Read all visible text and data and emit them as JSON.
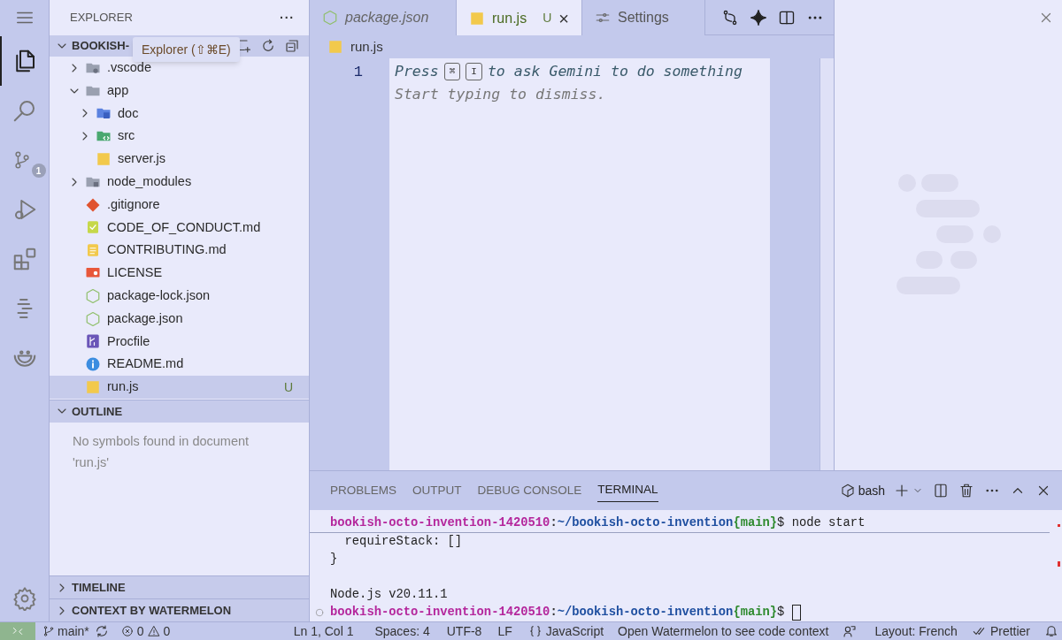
{
  "activity_bar": {
    "items": [
      {
        "kind": "files",
        "selected": true
      },
      {
        "kind": "search",
        "selected": false
      },
      {
        "kind": "scm",
        "selected": false,
        "badge": "1"
      },
      {
        "kind": "debug",
        "selected": false
      },
      {
        "kind": "extensions",
        "selected": false
      },
      {
        "kind": "timeline",
        "selected": false
      },
      {
        "kind": "smile",
        "selected": false
      }
    ]
  },
  "sidebar": {
    "title": "EXPLORER",
    "more": "···",
    "root": {
      "label": "BOOKISH-",
      "expanded": true
    },
    "tooltip": "Explorer (⇧⌘E)",
    "tree": [
      {
        "label": ".vscode",
        "kind": "vscode",
        "expanded": false,
        "selected": false
      },
      {
        "label": "app",
        "kind": "folder",
        "expanded": true,
        "selected": false,
        "children": [
          {
            "label": "doc",
            "kind": "docfolder",
            "expanded": false,
            "selected": false
          },
          {
            "label": "src",
            "kind": "srcfolder",
            "expanded": false,
            "selected": false
          },
          {
            "label": "server.js",
            "kind": "js",
            "selected": false
          }
        ]
      },
      {
        "label": "node_modules",
        "kind": "modules",
        "expanded": false,
        "selected": false
      },
      {
        "label": ".gitignore",
        "kind": "git",
        "selected": false
      },
      {
        "label": "CODE_OF_CONDUCT.md",
        "kind": "check",
        "selected": false
      },
      {
        "label": "CONTRIBUTING.md",
        "kind": "note",
        "selected": false
      },
      {
        "label": "LICENSE",
        "kind": "license",
        "selected": false
      },
      {
        "label": "package-lock.json",
        "kind": "node",
        "selected": false
      },
      {
        "label": "package.json",
        "kind": "node",
        "selected": false
      },
      {
        "label": "Procfile",
        "kind": "heroku",
        "selected": false
      },
      {
        "label": "README.md",
        "kind": "info",
        "selected": false
      },
      {
        "label": "run.js",
        "kind": "js",
        "selected": true,
        "badge": "U"
      }
    ],
    "sections": [
      {
        "title": "OUTLINE",
        "expanded": true,
        "message": "No symbols found in document 'run.js'"
      },
      {
        "title": "TIMELINE",
        "expanded": false
      },
      {
        "title": "CONTEXT BY WATERMELON",
        "expanded": false
      }
    ]
  },
  "editor": {
    "tabs": [
      {
        "label": "package.json",
        "kind": "node",
        "selected": false,
        "preview": true
      },
      {
        "label": "run.js",
        "kind": "js",
        "selected": true,
        "preview": false,
        "badge": "U",
        "close": "×"
      },
      {
        "label": "Settings",
        "kind": "settings",
        "selected": false,
        "preview": false
      }
    ],
    "breadcrumb": "run.js",
    "line_number": "1",
    "hint": {
      "press": "Press",
      "keys": [
        "⌘",
        "I"
      ],
      "rest": "to ask Gemini to do something",
      "second": "Start typing to dismiss."
    }
  },
  "panel": {
    "tabs": [
      {
        "label": "PROBLEMS",
        "selected": false
      },
      {
        "label": "OUTPUT",
        "selected": false
      },
      {
        "label": "DEBUG CONSOLE",
        "selected": false
      },
      {
        "label": "TERMINAL",
        "selected": true
      }
    ],
    "shell": "bash",
    "lines": [
      {
        "kind": "prompt",
        "segments": [
          {
            "text": "bookish-octo-invention-1420510",
            "color": "#b4269c"
          },
          {
            "text": ":",
            "color": "#333333"
          },
          {
            "text": "~/bookish-octo-invention",
            "color": "#1f4fa0"
          },
          {
            "text": "{main}",
            "color": "#2e8a2e"
          },
          {
            "text": "$ node start",
            "color": "#222222"
          }
        ],
        "cursor": false
      },
      {
        "kind": "output",
        "text": "  requireStack: []"
      },
      {
        "kind": "output",
        "text": "}"
      },
      {
        "kind": "blank"
      },
      {
        "kind": "output",
        "text": "Node.js v20.11.1"
      },
      {
        "kind": "prompt",
        "segments": [
          {
            "text": "bookish-octo-invention-1420510",
            "color": "#b4269c"
          },
          {
            "text": ":",
            "color": "#333333"
          },
          {
            "text": "~/bookish-octo-invention",
            "color": "#1f4fa0"
          },
          {
            "text": "{main}",
            "color": "#2e8a2e"
          },
          {
            "text": "$ ",
            "color": "#222222"
          }
        ],
        "cursor": true
      }
    ]
  },
  "status_bar": {
    "branch": "main*",
    "errors": "0",
    "warnings": "0",
    "items": [
      {
        "kind": "text",
        "text": "Ln 1, Col 1"
      },
      {
        "kind": "text",
        "text": "Spaces: 4"
      },
      {
        "kind": "text",
        "text": "UTF-8"
      },
      {
        "kind": "text",
        "text": "LF"
      },
      {
        "kind": "language",
        "text": "JavaScript"
      },
      {
        "kind": "text",
        "text": "Open Watermelon to see code context"
      },
      {
        "kind": "feedback"
      },
      {
        "kind": "text",
        "text": "Layout: French"
      },
      {
        "kind": "prettier",
        "text": "Prettier"
      },
      {
        "kind": "bell"
      }
    ]
  }
}
